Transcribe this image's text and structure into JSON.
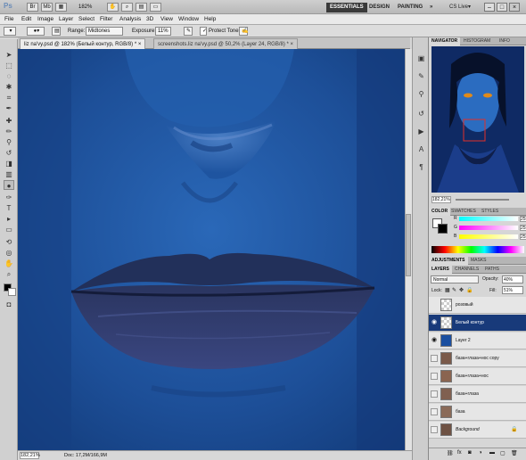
{
  "app": {
    "logo": "Ps",
    "zoom": "182%",
    "workspaces": [
      "ESSENTIALS",
      "DESIGN",
      "PAINTING",
      "»"
    ],
    "cs_live": "CS Live▾",
    "win_buttons": [
      "–",
      "□",
      "×"
    ]
  },
  "menubar": [
    "File",
    "Edit",
    "Image",
    "Layer",
    "Select",
    "Filter",
    "Analysis",
    "3D",
    "View",
    "Window",
    "Help"
  ],
  "options": {
    "range_label": "Range:",
    "range_value": "Midtones",
    "exposure_label": "Exposure:",
    "exposure_value": "11%",
    "protect_tones": "Protect Tones"
  },
  "tabs": [
    {
      "label": "liz na'vy.psd @ 182% (Белый контур, RGB/8) *  ×"
    },
    {
      "label": "screenshots.liz na'vy.psd @ 50,2% (Layer 24, RGB/8) *  ×"
    }
  ],
  "status": {
    "zoom": "182,21%",
    "doc": "Doc: 17,2M/166,9M"
  },
  "navigator": {
    "tabs": [
      "NAVIGATOR",
      "HISTOGRAM",
      "INFO"
    ],
    "zoom": "182,21%"
  },
  "color_panel": {
    "tabs": [
      "COLOR",
      "SWATCHES",
      "STYLES"
    ],
    "channels": [
      {
        "label": "R",
        "value": "255"
      },
      {
        "label": "G",
        "value": "255"
      },
      {
        "label": "B",
        "value": "255"
      }
    ]
  },
  "adjustments": {
    "tabs": [
      "ADJUSTMENTS",
      "MASKS"
    ]
  },
  "layers": {
    "tabs": [
      "LAYERS",
      "CHANNELS",
      "PATHS"
    ],
    "blend_mode": "Normal",
    "opacity_label": "Opacity:",
    "opacity": "40%",
    "lock_label": "Lock:",
    "fill_label": "Fill:",
    "fill": "51%",
    "items": [
      {
        "name": "розовый",
        "visible": false,
        "selected": false
      },
      {
        "name": "Белый контур",
        "visible": true,
        "selected": true
      },
      {
        "name": "Layer 2",
        "visible": true,
        "selected": false
      },
      {
        "name": "база+глаза+нос copy",
        "visible": false,
        "selected": false
      },
      {
        "name": "база+глаза+нос",
        "visible": false,
        "selected": false
      },
      {
        "name": "база+глаза",
        "visible": false,
        "selected": false
      },
      {
        "name": "база",
        "visible": false,
        "selected": false
      },
      {
        "name": "Background",
        "visible": false,
        "selected": false
      }
    ]
  },
  "colors": {
    "canvas_skin": "#1f5aa6",
    "canvas_lips": "#2b3a6a",
    "selected_layer": "#183a7a"
  }
}
